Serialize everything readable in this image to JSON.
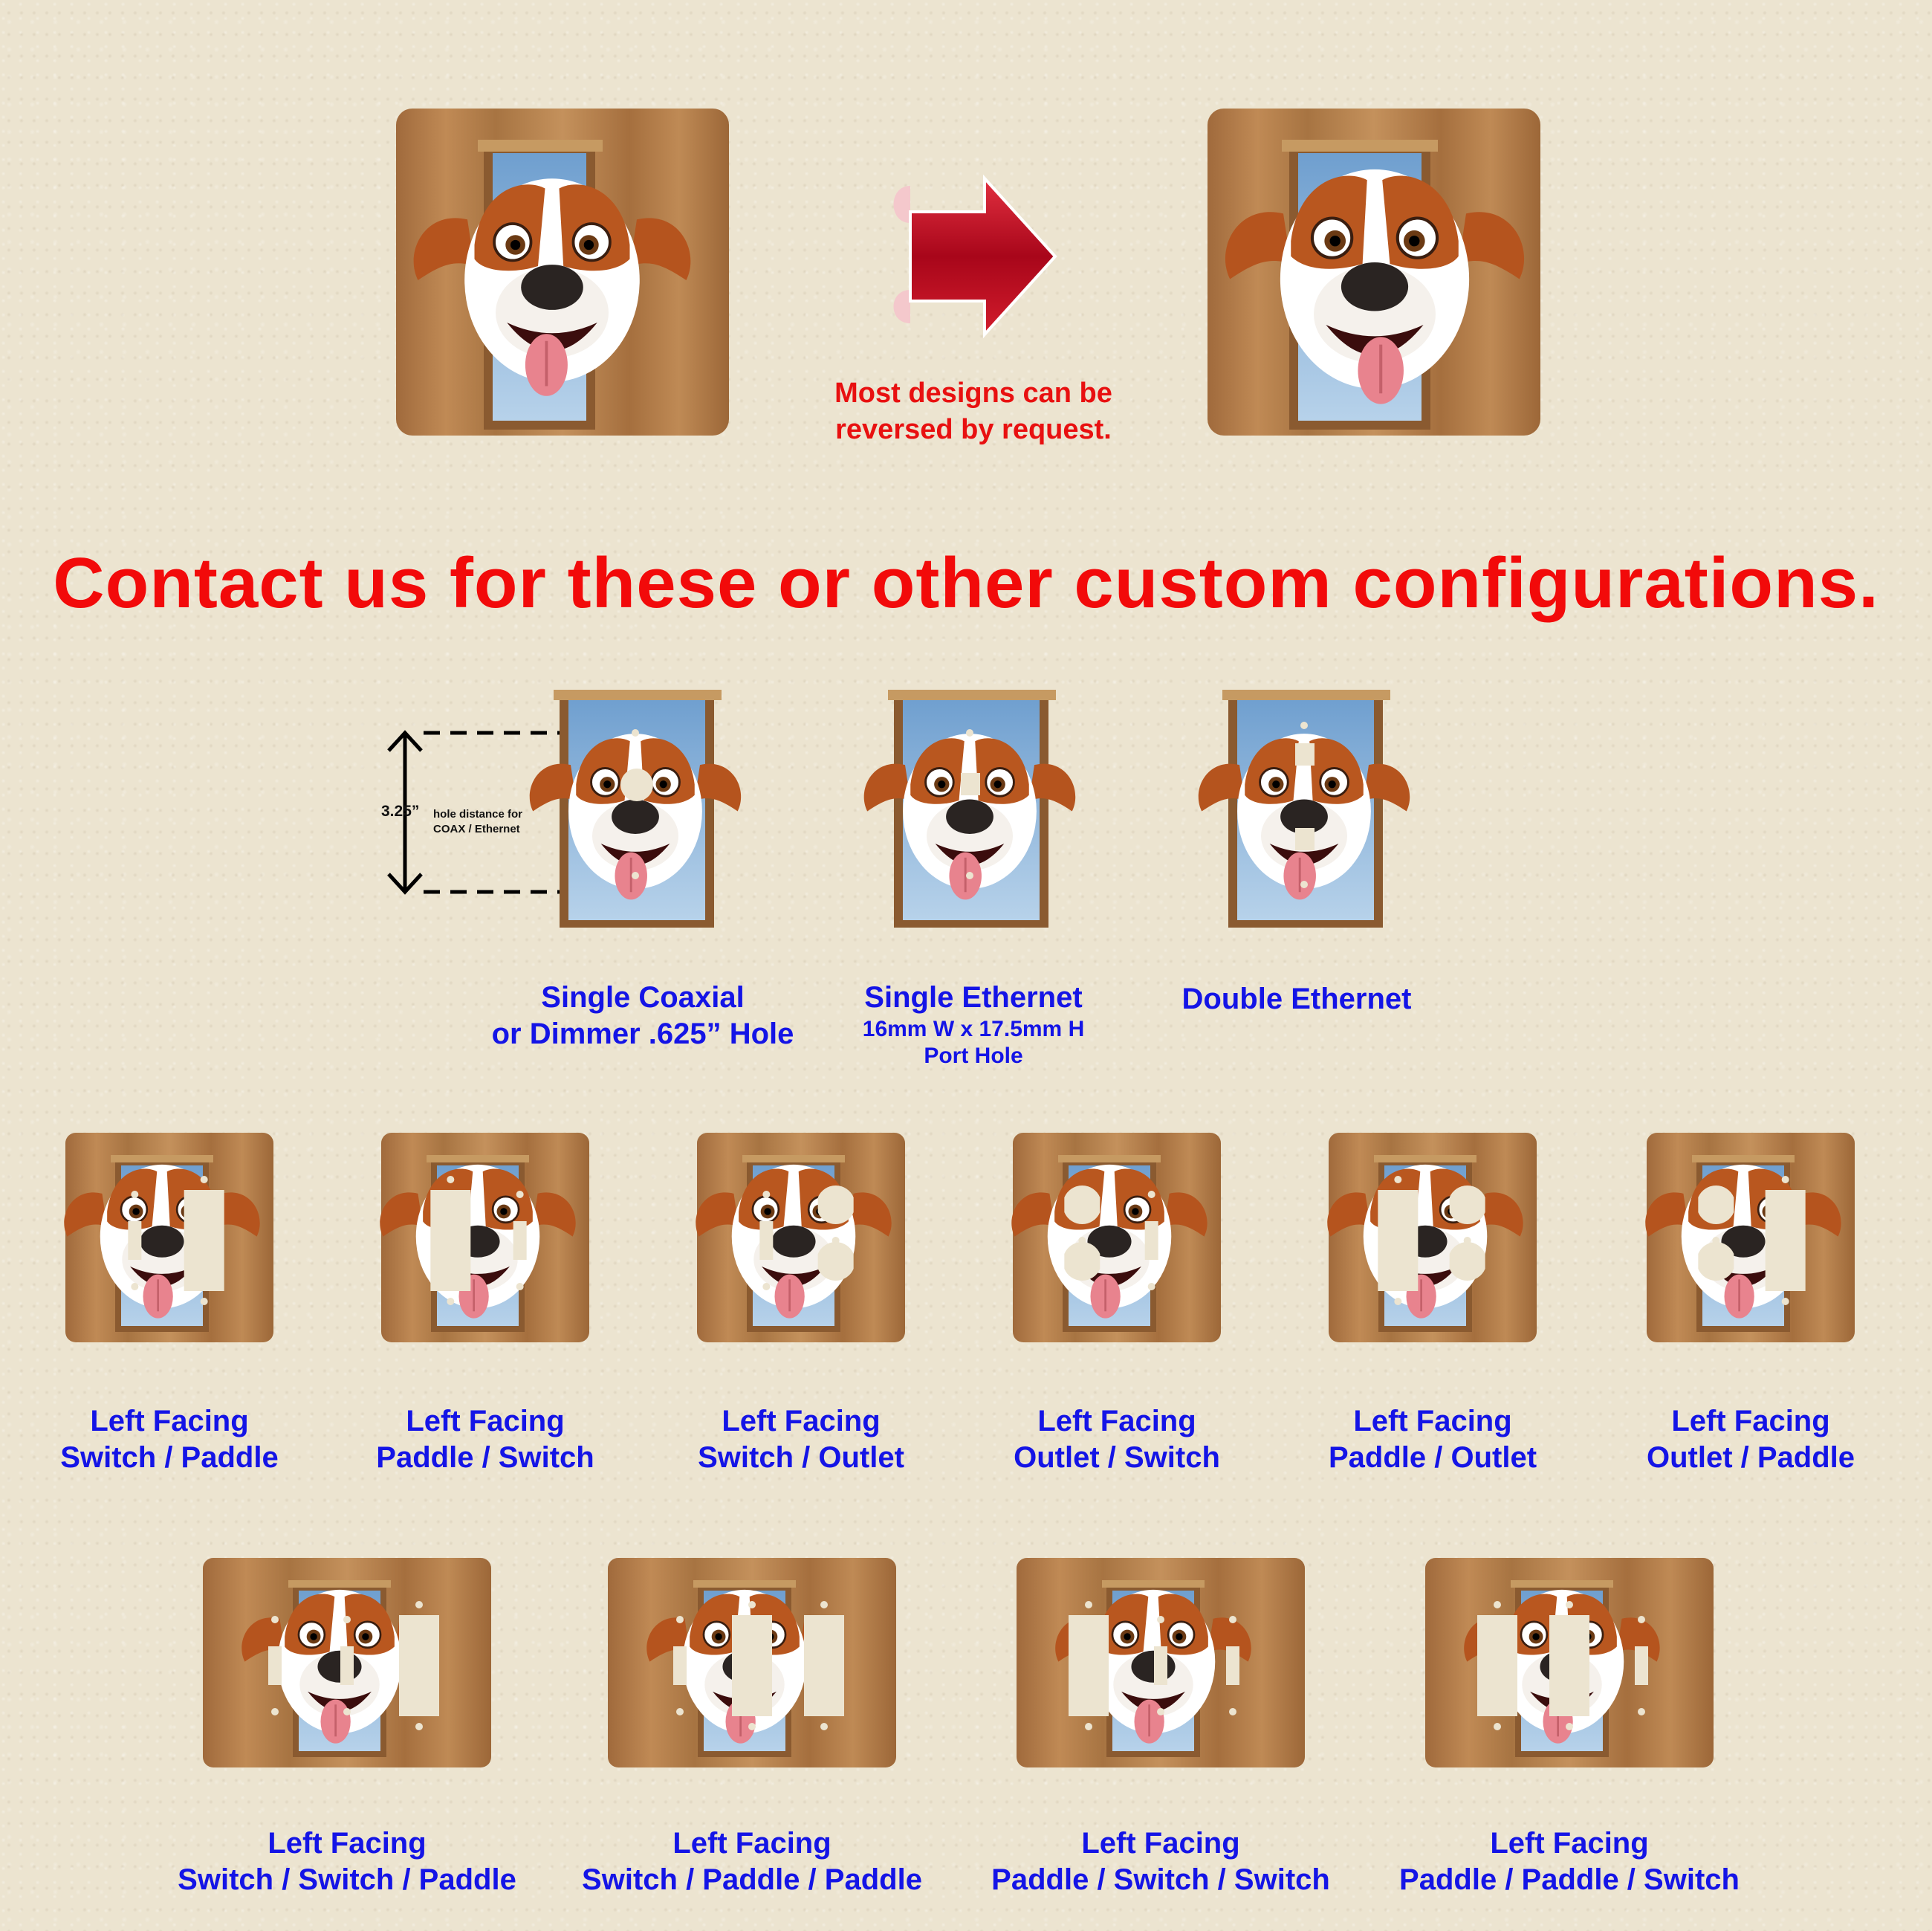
{
  "reversal": {
    "note_line1": "Most designs can be",
    "note_line2": "reversed by request."
  },
  "headline": "Contact us for these or other custom configurations.",
  "dimension": {
    "value": "3.25”",
    "caption_line1": "hole distance for",
    "caption_line2": "COAX / Ethernet"
  },
  "single_plates": [
    {
      "line1": "Single Coaxial",
      "line2": "or Dimmer .625” Hole"
    },
    {
      "line1": "Single Ethernet",
      "line2": "16mm W x 17.5mm H",
      "line3": "Port Hole"
    },
    {
      "line1": "Double Ethernet"
    }
  ],
  "double_plates": [
    {
      "line1": "Left Facing",
      "line2": "Switch / Paddle"
    },
    {
      "line1": "Left Facing",
      "line2": "Paddle / Switch"
    },
    {
      "line1": "Left Facing",
      "line2": "Switch / Outlet"
    },
    {
      "line1": "Left Facing",
      "line2": "Outlet / Switch"
    },
    {
      "line1": "Left Facing",
      "line2": "Paddle / Outlet"
    },
    {
      "line1": "Left Facing",
      "line2": "Outlet / Paddle"
    }
  ],
  "triple_plates": [
    {
      "line1": "Left Facing",
      "line2": "Switch / Switch / Paddle"
    },
    {
      "line1": "Left Facing",
      "line2": "Switch / Paddle / Paddle"
    },
    {
      "line1": "Left Facing",
      "line2": "Paddle / Switch / Switch"
    },
    {
      "line1": "Left Facing",
      "line2": "Paddle / Paddle / Switch"
    }
  ],
  "colors": {
    "label_blue": "#1414e6",
    "headline_red": "#f20a0a",
    "arrow_red": "#c4101c",
    "wood": "#b27d4a",
    "background": "#ece4d0"
  },
  "icons": [
    "red-arrow-icon",
    "dog-face-icon",
    "dimension-arrow-icon"
  ]
}
